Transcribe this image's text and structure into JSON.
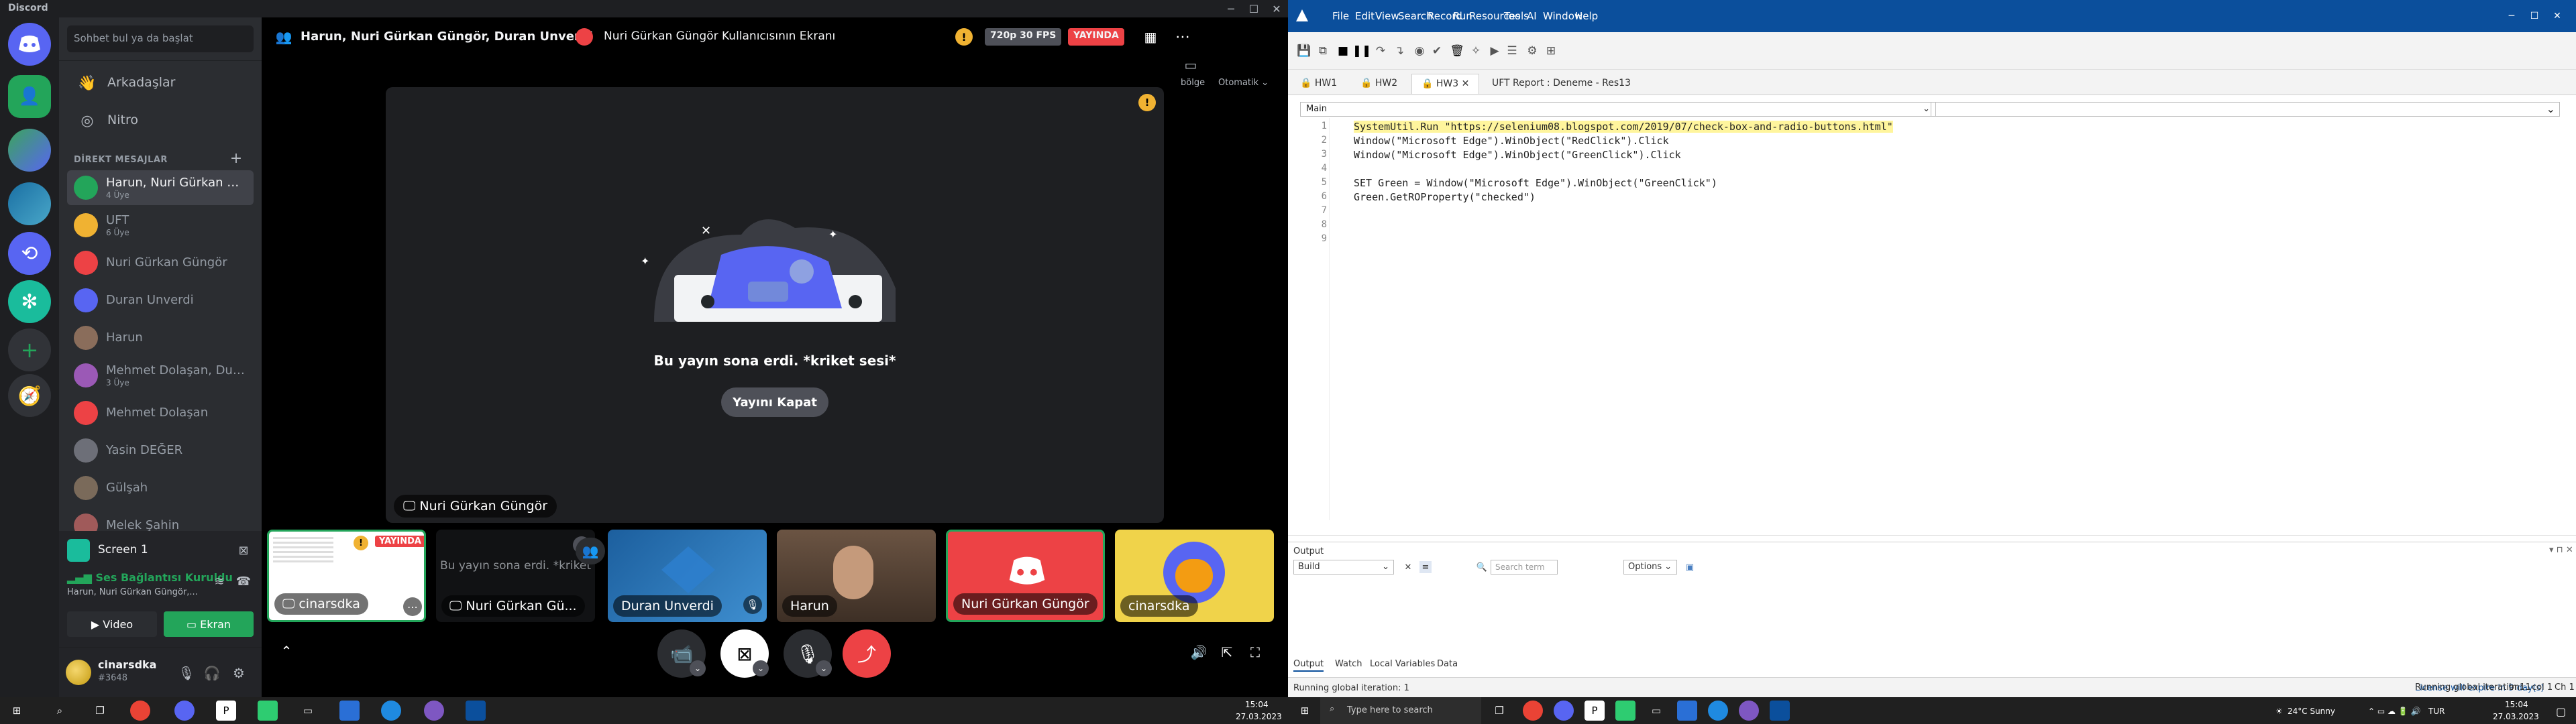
{
  "discord": {
    "title": "Discord",
    "search_placeholder": "Sohbet bul ya da başlat",
    "nav": [
      {
        "label": "Arkadaşlar"
      },
      {
        "label": "Nitro"
      }
    ],
    "dm_header": "DİREKT MESAJLAR",
    "dms": [
      {
        "name": "Harun, Nuri Gürkan G...",
        "sub": "4 Üye",
        "color": "#23a55a"
      },
      {
        "name": "UFT",
        "sub": "6 Üye",
        "color": "#f0b232"
      },
      {
        "name": "Nuri Gürkan Güngör",
        "sub": "",
        "color": "#ed4245"
      },
      {
        "name": "Duran Unverdi",
        "sub": "",
        "color": "#5865f2"
      },
      {
        "name": "Harun",
        "sub": "",
        "color": "#8a6d5b"
      },
      {
        "name": "Mehmet Dolaşan, Dur...",
        "sub": "3 Üye",
        "color": "#9b59b6"
      },
      {
        "name": "Mehmet Dolaşan",
        "sub": "",
        "color": "#ed4245"
      },
      {
        "name": "Yasin DEĞER",
        "sub": "",
        "color": "#6d6f78"
      },
      {
        "name": "Gülşah",
        "sub": "",
        "color": "#7a6a5a"
      },
      {
        "name": "Melek Şahin",
        "sub": "",
        "color": "#a05a5a"
      }
    ],
    "voice": {
      "screen_label": "Screen 1",
      "connection": "Ses Bağlantısı Kuruldu",
      "channel": "Harun, Nuri Gürkan Güngör,...",
      "video_button": "Video",
      "screen_button": "Ekran"
    },
    "user": {
      "name": "cinarsdka",
      "tag": "#3648"
    },
    "header": {
      "title": "Harun, Nuri Gürkan Güngör, Duran Unverdi",
      "stream_title": "Nuri Gürkan Güngör Kullanıcısının Ekranı",
      "quality": "720p 30 FPS",
      "live": "YAYINDA",
      "region_label": "bölge",
      "region_value": "Otomatik"
    },
    "stream": {
      "ended_text": "Bu yayın sona erdi. *kriket sesi*",
      "close_button": "Yayını Kapat",
      "owner": "Nuri Gürkan Güngör"
    },
    "tiles": [
      {
        "label": "cinarsdka",
        "live": "YAYINDA"
      },
      {
        "label": "Nuri Gürkan Gü...",
        "preview": "Bu yayın sona erdi. *kriket"
      },
      {
        "label": "Duran Unverdi"
      },
      {
        "label": "Harun"
      },
      {
        "label": "Nuri Gürkan Güngör"
      },
      {
        "label": "cinarsdka"
      }
    ]
  },
  "uft": {
    "menu": [
      "File",
      "Edit",
      "View",
      "Search",
      "Record",
      "Run",
      "Resources",
      "Tools",
      "AI",
      "Window",
      "Help"
    ],
    "tabs": [
      "HW1",
      "HW2",
      "HW3",
      "UFT Report : Deneme - Res13"
    ],
    "combo_left": "Main",
    "code_lines": [
      "SystemUtil.Run \"https://selenium08.blogspot.com/2019/07/check-box-and-radio-buttons.html\"",
      "Window(\"Microsoft Edge\").WinObject(\"RedClick\").Click",
      "Window(\"Microsoft Edge\").WinObject(\"GreenClick\").Click",
      "",
      "SET Green = Window(\"Microsoft Edge\").WinObject(\"GreenClick\")",
      "Green.GetROProperty(\"checked\")",
      "",
      "",
      ""
    ],
    "line_numbers": [
      "1",
      "2",
      "3",
      "4",
      "5",
      "6",
      "7",
      "8",
      "9"
    ],
    "output": {
      "title": "Output",
      "build": "Build",
      "search_placeholder": "Search term",
      "options": "Options",
      "tabs": [
        "Output",
        "Watch",
        "Local Variables",
        "Data"
      ]
    },
    "status": {
      "left": "Running global iteration: 1",
      "license": "License will expire in 9 day(s)",
      "run": "Running global iteration: 1",
      "ln": "ln 1",
      "col": "col 1",
      "ch": "Ch 1"
    }
  },
  "taskbar_left": {
    "time": "15:04",
    "date": "27.03.2023"
  },
  "taskbar_right": {
    "search_placeholder": "Type here to search",
    "weather": "24°C  Sunny",
    "lang": "TUR",
    "time": "15:04",
    "date": "27.03.2023"
  }
}
